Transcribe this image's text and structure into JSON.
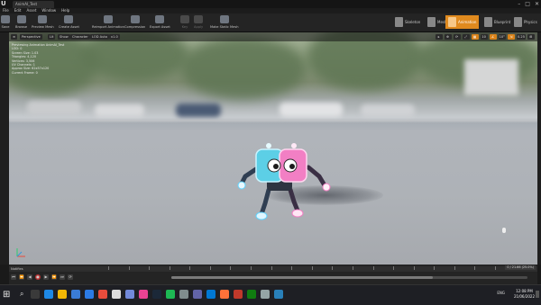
{
  "window": {
    "tab_title": "AnimAI_Test",
    "controls": [
      "–",
      "□",
      "✕"
    ]
  },
  "menu": [
    "File",
    "Edit",
    "Asset",
    "Window",
    "Help"
  ],
  "toolbar": {
    "buttons": [
      {
        "label": "Save",
        "enabled": true
      },
      {
        "label": "Browse",
        "enabled": true
      },
      {
        "label": "Preview Mesh",
        "enabled": true
      },
      {
        "label": "Create Asset",
        "enabled": true
      },
      {
        "label": "Reimport Animation",
        "enabled": true
      },
      {
        "label": "Compression",
        "enabled": true
      },
      {
        "label": "Export Asset",
        "enabled": true
      },
      {
        "label": "Key",
        "enabled": false
      },
      {
        "label": "Apply",
        "enabled": false
      },
      {
        "label": "Make Static Mesh",
        "enabled": true
      }
    ],
    "modes": [
      {
        "label": "Skeleton",
        "active": false
      },
      {
        "label": "Mesh",
        "active": false
      },
      {
        "label": "Animation",
        "active": true
      },
      {
        "label": "Blueprint",
        "active": false
      },
      {
        "label": "Physics",
        "active": false
      }
    ]
  },
  "viewport": {
    "buttons": [
      "≡",
      "Perspective",
      "Lit",
      "Show",
      "Character",
      "LOD Auto",
      "x1.0"
    ],
    "right_tools": [
      "▸",
      "⊕",
      "⟳",
      "⤢",
      "▦",
      "10",
      "∠",
      "10°",
      "⇲",
      "0.25",
      "⊞"
    ],
    "stats": "Previewing Animation AnimAI_Test\nLOD: 0\nScreen Size: 1.03\nTriangles: 4,120\nVertices: 3,506\nUV Channels: 1\nApprox Size: 62x57x120\nCurrent Frame: 0"
  },
  "timeline": {
    "track_label": "Notifies",
    "timecode": "0 / 21.66 (25.0%)",
    "transport": [
      "⏮",
      "⏪",
      "◀",
      "●",
      "▶",
      "⏩",
      "⏭",
      "⟳"
    ]
  },
  "taskbar": {
    "start_icon": "windows-logo",
    "search": "⌕",
    "icons": [
      {
        "name": "task-view-icon",
        "color": "#3a3a3a"
      },
      {
        "name": "edge-icon",
        "color": "#1e88e5"
      },
      {
        "name": "file-explorer-icon",
        "color": "#f2b705"
      },
      {
        "name": "store-icon",
        "color": "#3a7bd5"
      },
      {
        "name": "mail-icon",
        "color": "#2c7be5"
      },
      {
        "name": "chrome-icon",
        "color": "#e74c3c"
      },
      {
        "name": "unreal-icon",
        "color": "#dddddd"
      },
      {
        "name": "discord-icon",
        "color": "#7289da"
      },
      {
        "name": "app-icon-pink",
        "color": "#e84393"
      },
      {
        "name": "steam-icon",
        "color": "#1b2838"
      },
      {
        "name": "spotify-icon",
        "color": "#1db954"
      },
      {
        "name": "settings-icon",
        "color": "#7f8c8d"
      },
      {
        "name": "teams-icon",
        "color": "#6264a7"
      },
      {
        "name": "photos-icon",
        "color": "#0078d4"
      },
      {
        "name": "firefox-icon",
        "color": "#ff7139"
      },
      {
        "name": "app-icon-red",
        "color": "#c0392b"
      },
      {
        "name": "xbox-icon",
        "color": "#107c10"
      },
      {
        "name": "app-icon-grey",
        "color": "#95a5a6"
      },
      {
        "name": "app-icon-blue",
        "color": "#2980b9"
      }
    ],
    "tray": "ENG",
    "time": "12:08 PM",
    "date": "21/06/2022"
  },
  "colors": {
    "accent": "#e08a1e",
    "robot_blue": "#5ccfe6",
    "robot_pink": "#f27fc4"
  }
}
